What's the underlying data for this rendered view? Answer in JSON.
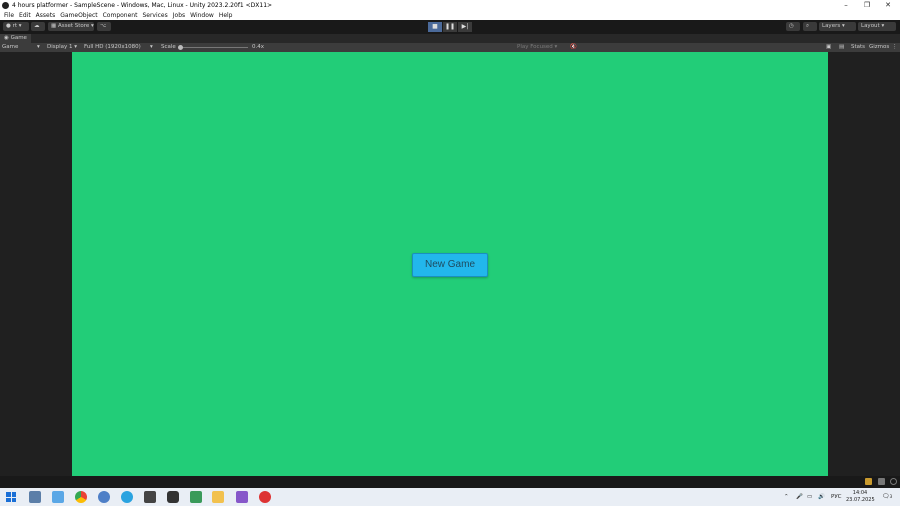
{
  "window": {
    "title": "4 hours platformer - SampleScene - Windows, Mac, Linux - Unity 2023.2.20f1 <DX11>",
    "min_label": "–",
    "max_label": "❐",
    "close_label": "✕"
  },
  "menu": [
    "File",
    "Edit",
    "Assets",
    "GameObject",
    "Component",
    "Services",
    "Jobs",
    "Window",
    "Help"
  ],
  "toolbar": {
    "account_label": "rt",
    "asset_store_label": "Asset Store",
    "layers_label": "Layers",
    "layout_label": "Layout"
  },
  "tab": {
    "label": "Game"
  },
  "gamebar": {
    "view_select": "Game",
    "display_select": "Display 1",
    "resolution_select": "Full HD (1920x1080)",
    "scale_label": "Scale",
    "scale_value": "0.4x",
    "play_mode_select": "Play Focused",
    "stats_label": "Stats",
    "gizmos_label": "Gizmos"
  },
  "game": {
    "background_color": "#22cd78",
    "button_label": "New Game",
    "button_color": "#22b7ec"
  },
  "taskbar": {
    "language": "РУС",
    "time": "14:04",
    "date": "23.07.2025",
    "notifications_count": "3"
  }
}
